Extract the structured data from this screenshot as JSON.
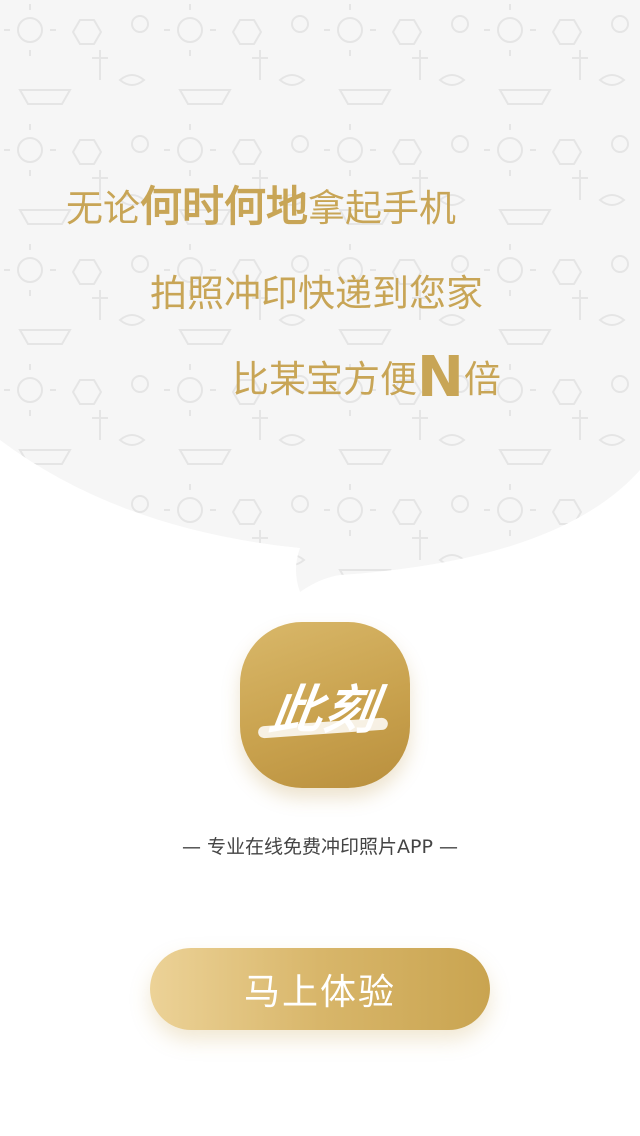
{
  "headline": {
    "line1_prefix": "无论",
    "line1_bold": "何时何地",
    "line1_suffix": "拿起手机",
    "line2": "拍照冲印快递到您家",
    "line3_prefix": "比某宝方便",
    "line3_bold": "N",
    "line3_suffix": "倍"
  },
  "app": {
    "logo_text": "此刻",
    "tagline": "— 专业在线免费冲印照片APP —"
  },
  "cta": {
    "label": "马上体验"
  },
  "colors": {
    "accent_gold": "#c8a556",
    "bubble_bg": "#f6f6f6",
    "button_light": "#ecd297",
    "button_dark": "#c9a450"
  }
}
